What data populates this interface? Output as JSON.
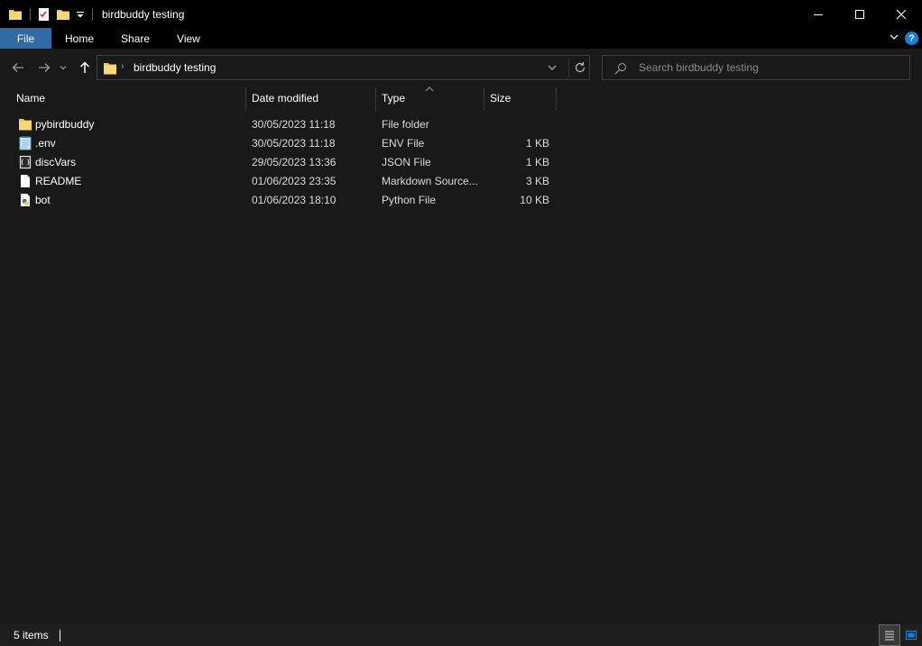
{
  "window": {
    "title": "birdbuddy testing"
  },
  "ribbon": {
    "tabs": [
      {
        "label": "File"
      },
      {
        "label": "Home"
      },
      {
        "label": "Share"
      },
      {
        "label": "View"
      }
    ],
    "help_label": "?"
  },
  "address": {
    "crumb": "birdbuddy testing",
    "separator": "›"
  },
  "search": {
    "placeholder": "Search birdbuddy testing"
  },
  "columns": {
    "name": "Name",
    "date": "Date modified",
    "type": "Type",
    "size": "Size"
  },
  "files": [
    {
      "name": "pybirdbuddy",
      "date": "30/05/2023 11:18",
      "type": "File folder",
      "size": "",
      "icon": "folder-icon"
    },
    {
      "name": ".env",
      "date": "30/05/2023 11:18",
      "type": "ENV File",
      "size": "1 KB",
      "icon": "notepad-file-icon"
    },
    {
      "name": "discVars",
      "date": "29/05/2023 13:36",
      "type": "JSON File",
      "size": "1 KB",
      "icon": "json-file-icon"
    },
    {
      "name": "README",
      "date": "01/06/2023 23:35",
      "type": "Markdown Source...",
      "size": "3 KB",
      "icon": "blank-file-icon"
    },
    {
      "name": "bot",
      "date": "01/06/2023 18:10",
      "type": "Python File",
      "size": "10 KB",
      "icon": "python-file-icon"
    }
  ],
  "status": {
    "count": "5 items"
  },
  "colors": {
    "accent": "#2f6aa5",
    "folder": "#f2c55c",
    "background": "#191919",
    "titlebar": "#000000"
  }
}
